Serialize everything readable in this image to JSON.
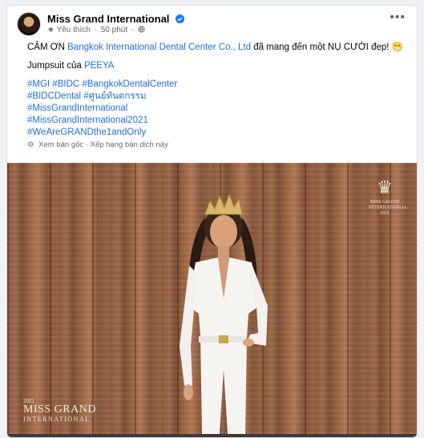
{
  "post": {
    "page_name": "Miss Grand International",
    "meta": {
      "liked_label": "Yêu thích",
      "time": "50 phút"
    },
    "text": {
      "line1_prefix": "CẢM ƠN ",
      "line1_link": "Bangkok International Dental Center Co., Ltd",
      "line1_suffix": " đã mang đến một NỤ CƯỜI đẹp! 😁",
      "line2_prefix": "Jumpsuit của ",
      "line2_link": "PEEYA"
    },
    "hashtags": [
      "#MGI #BIDC #BangkokDentalCenter",
      "#BIDCDental #ศูนย์ทันตกรรม",
      "#MissGrandInternational",
      "#MissGrandInternational2021",
      "#WeAreGRANDthe1andOnly"
    ],
    "translation": {
      "see_original": "Xem bản gốc",
      "rate_translation": "Xếp hạng bản dịch này"
    },
    "photo": {
      "watermark_top": [
        "MISS GRAND",
        "INTERNATIONAL",
        "2021"
      ],
      "watermark_bottom": {
        "year": "2021",
        "title": "MISS GRAND",
        "subtitle": "INTERNATIONAL"
      }
    }
  },
  "icons": {
    "verified": "verified-badge-icon",
    "liked": "star-icon",
    "audience": "globe-icon",
    "more": "more-options-icon",
    "translate": "gear-icon"
  },
  "colors": {
    "link": "#216fdb",
    "verified": "#1877f2",
    "muted": "#65676b"
  }
}
